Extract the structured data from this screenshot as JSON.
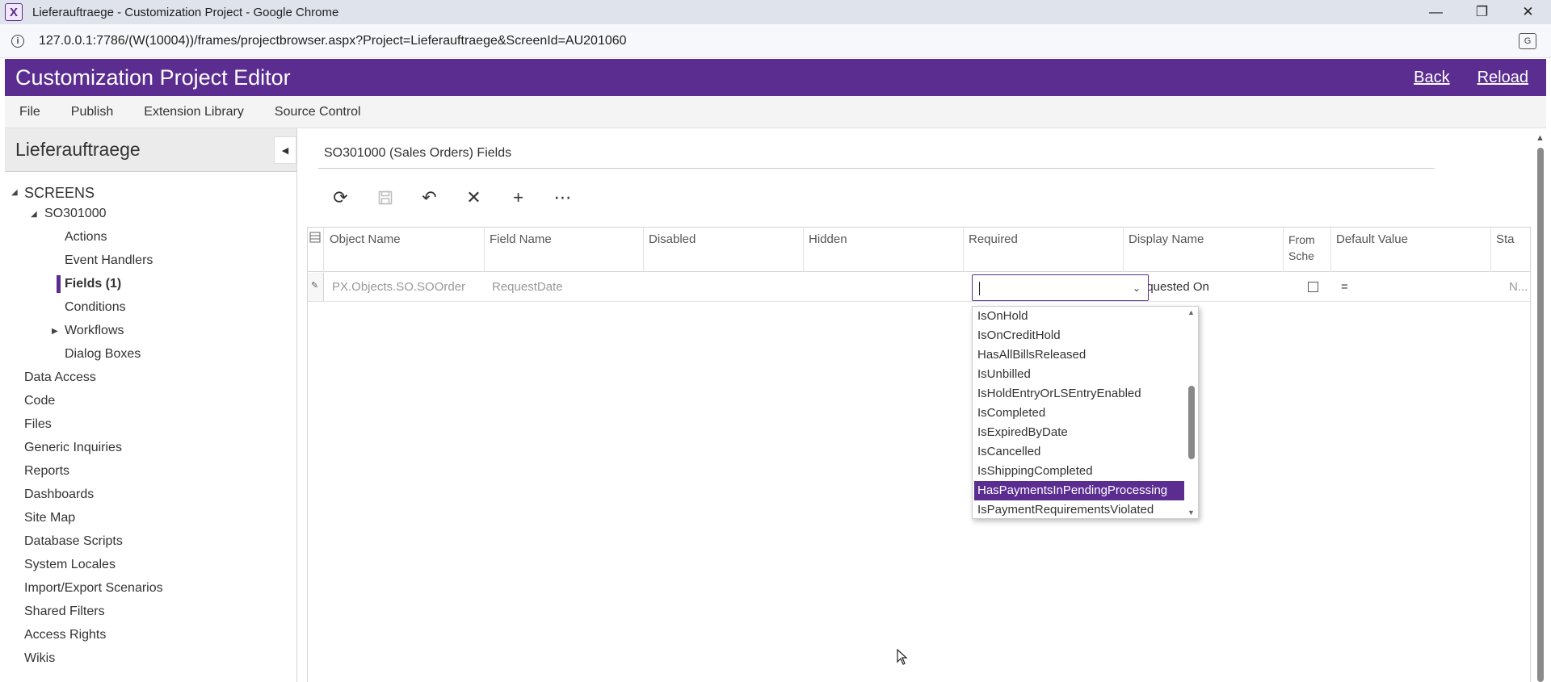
{
  "window": {
    "title": "Lieferauftraege - Customization Project - Google Chrome",
    "controls": [
      "minimize",
      "restore",
      "close"
    ]
  },
  "browser": {
    "url": "127.0.0.1:7786/(W(10004))/frames/projectbrowser.aspx?Project=Lieferauftraege&ScreenId=AU201060"
  },
  "app": {
    "title": "Customization Project Editor",
    "links": {
      "back": "Back",
      "reload": "Reload"
    },
    "menu": [
      "File",
      "Publish",
      "Extension Library",
      "Source Control"
    ],
    "accent_color": "#5b2d91"
  },
  "sidebar": {
    "title": "Lieferauftraege",
    "screens_label": "SCREENS",
    "screen_id": "SO301000",
    "screen_children": [
      "Actions",
      "Event Handlers",
      "Fields (1)",
      "Conditions",
      "Workflows",
      "Dialog Boxes"
    ],
    "selected": "Fields (1)",
    "items": [
      "Data Access",
      "Code",
      "Files",
      "Generic Inquiries",
      "Reports",
      "Dashboards",
      "Site Map",
      "Database Scripts",
      "System Locales",
      "Import/Export Scenarios",
      "Shared Filters",
      "Access Rights",
      "Wikis"
    ]
  },
  "main": {
    "section_title": "SO301000 (Sales Orders) Fields",
    "toolbar": [
      "refresh-icon",
      "save-icon",
      "undo-icon",
      "delete-icon",
      "add-icon",
      "more-icon"
    ],
    "columns": [
      "Object Name",
      "Field Name",
      "Disabled",
      "Hidden",
      "Required",
      "Display Name",
      "From Sche",
      "Default Value",
      "Sta"
    ],
    "row": {
      "object_name": "PX.Objects.SO.SOOrder",
      "field_name": "RequestDate",
      "display_name": "equested On",
      "default_value": "=",
      "status": "N..."
    }
  },
  "dropdown": {
    "options": [
      "IsOnHold",
      "IsOnCreditHold",
      "HasAllBillsReleased",
      "IsUnbilled",
      "IsHoldEntryOrLSEntryEnabled",
      "IsCompleted",
      "IsExpiredByDate",
      "IsCancelled",
      "IsShippingCompleted",
      "HasPaymentsInPendingProcessing",
      "IsPaymentRequirementsViolated"
    ],
    "highlighted": "HasPaymentsInPendingProcessing"
  }
}
